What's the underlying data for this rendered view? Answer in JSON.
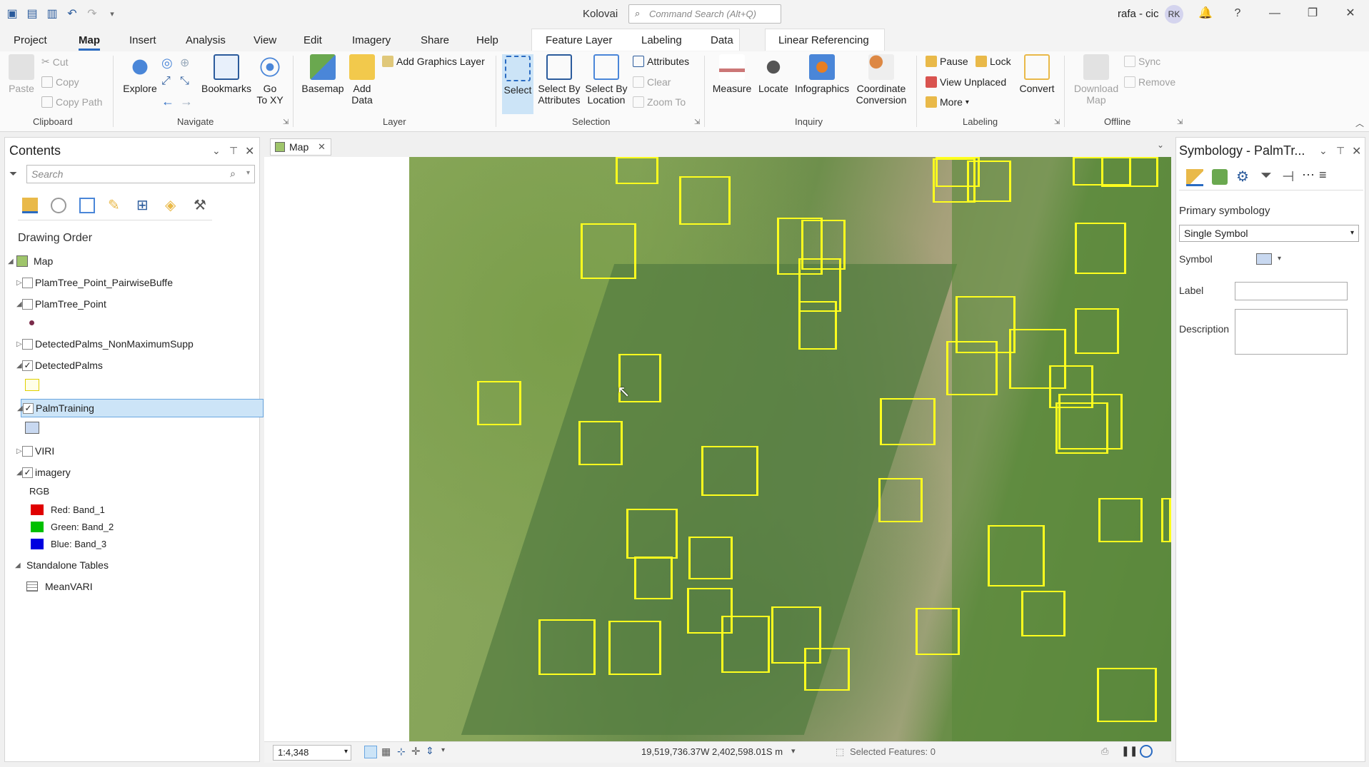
{
  "app_title": "Kolovai",
  "command_search": {
    "placeholder": "Command Search (Alt+Q)"
  },
  "user": {
    "name": "rafa - cic",
    "initials": "RK"
  },
  "menu": {
    "tabs": [
      "Project",
      "Map",
      "Insert",
      "Analysis",
      "View",
      "Edit",
      "Imagery",
      "Share",
      "Help"
    ],
    "active": "Map",
    "context_tabs": [
      "Feature Layer",
      "Labeling",
      "Data"
    ],
    "extra_tab": "Linear Referencing"
  },
  "ribbon": {
    "clipboard": {
      "label": "Clipboard",
      "paste": "Paste",
      "cut": "Cut",
      "copy": "Copy",
      "copy_path": "Copy Path"
    },
    "navigate": {
      "label": "Navigate",
      "explore": "Explore",
      "bookmarks": "Bookmarks",
      "go_to_xy_line1": "Go",
      "go_to_xy_line2": "To XY"
    },
    "layer": {
      "label": "Layer",
      "basemap": "Basemap",
      "add_data_line1": "Add",
      "add_data_line2": "Data",
      "add_graphics_layer": "Add Graphics Layer"
    },
    "selection": {
      "label": "Selection",
      "select": "Select",
      "select_by_attributes_line1": "Select By",
      "select_by_attributes_line2": "Attributes",
      "select_by_location_line1": "Select By",
      "select_by_location_line2": "Location",
      "attributes": "Attributes",
      "clear": "Clear",
      "zoom_to": "Zoom To"
    },
    "inquiry": {
      "label": "Inquiry",
      "measure": "Measure",
      "locate": "Locate",
      "infographics": "Infographics",
      "coordinate_conversion_line1": "Coordinate",
      "coordinate_conversion_line2": "Conversion"
    },
    "labeling": {
      "label": "Labeling",
      "pause": "Pause",
      "lock": "Lock",
      "view_unplaced": "View Unplaced",
      "more": "More",
      "convert": "Convert"
    },
    "offline": {
      "label": "Offline",
      "download_map_line1": "Download",
      "download_map_line2": "Map",
      "sync": "Sync",
      "remove": "Remove"
    }
  },
  "contents": {
    "title": "Contents",
    "search_placeholder": "Search",
    "heading": "Drawing Order",
    "layers": [
      {
        "name": "Map",
        "checked": null
      },
      {
        "name": "PlamTree_Point_PairwiseBuffe",
        "checked": false
      },
      {
        "name": "PlamTree_Point",
        "checked": false
      },
      {
        "name": "DetectedPalms_NonMaximumSupp",
        "checked": false
      },
      {
        "name": "DetectedPalms",
        "checked": true
      },
      {
        "name": "PalmTraining",
        "checked": true
      },
      {
        "name": "VIRI",
        "checked": false
      },
      {
        "name": "imagery",
        "checked": true
      }
    ],
    "rgb": {
      "label": "RGB",
      "red": "Red:  Band_1",
      "green": "Green: Band_2",
      "blue": "Blue:  Band_3"
    },
    "standalone_tables": "Standalone Tables",
    "table_name": "MeanVARI"
  },
  "map_view": {
    "tab_label": "Map",
    "scale": "1:4,348",
    "coordinates": "19,519,736.37W 2,402,598.01S m",
    "selected_features": "Selected Features: 0"
  },
  "symbology": {
    "title": "Symbology - PalmTr...",
    "primary": "Primary symbology",
    "mode": "Single Symbol",
    "symbol_label": "Symbol",
    "symbol_color": "#c8d8f0",
    "label_label": "Label",
    "description_label": "Description"
  },
  "colors": {
    "accent": "#2a6bc2",
    "detection_box": "#ffff1e",
    "selected_row": "#cce4f7"
  }
}
